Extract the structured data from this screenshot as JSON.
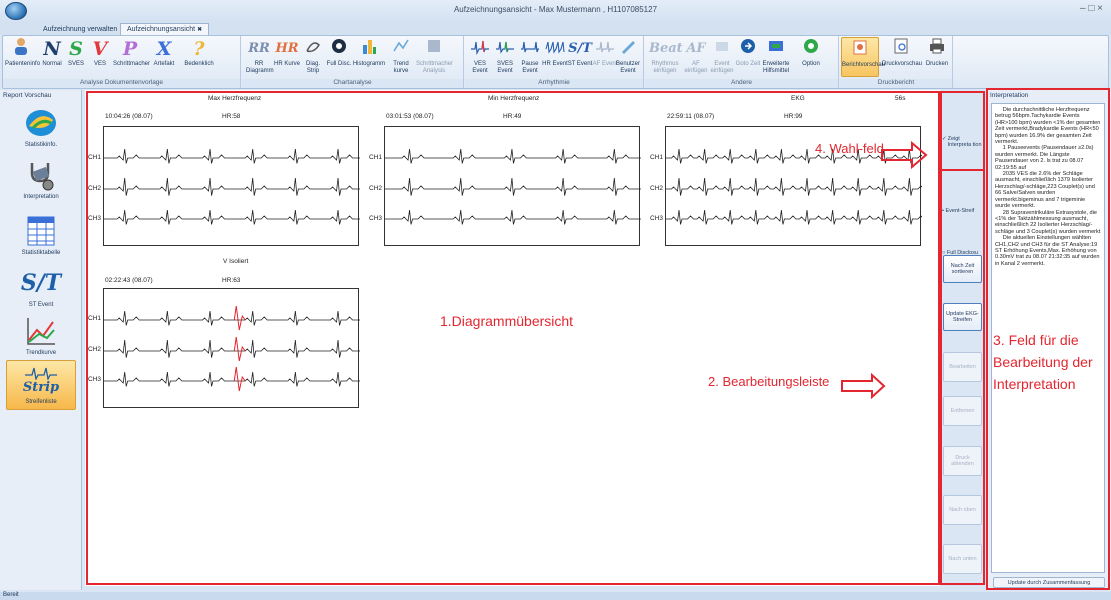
{
  "window": {
    "title": "Aufzeichnungsansicht - Max Mustermann , H1107085127",
    "controls": "– □ ×"
  },
  "tabs": [
    {
      "label": "Aufzeichnung verwalten"
    },
    {
      "label": "Aufzeichnungsansicht",
      "close": "✖"
    }
  ],
  "ribbon": {
    "groups": {
      "analysis_template": "Analyse Dokumentenvorlage",
      "chart_analysis": "Chartanalyse",
      "arrhythmia": "Arrhythmie",
      "other": "Andere",
      "print_report": "Druckbericht"
    },
    "buttons": {
      "patient_info": "Patienteninfo",
      "normal": "Normal",
      "sves": "SVES",
      "ves": "VES",
      "pacemaker": "Schrittmacher",
      "artifact": "Artefakt",
      "questionable": "Bedenklich",
      "rr_diagram": "RR Diagramm",
      "hr_curve": "HR Kurve",
      "diag_strip": "Diag. Strip",
      "full_disc": "Full Disc.",
      "histogram": "Histogramm",
      "trend_curve": "Trend kurve",
      "pacemaker_analysis": "Schrittmacher Analysis",
      "ves_event": "VES Event",
      "sves_event": "SVES Event",
      "pause_event": "Pause Event",
      "hr_event": "HR Event",
      "st_event": "ST Event",
      "af_event": "AF Event",
      "user_event": "Benutzer Event",
      "rhythm_insert": "Rhythmus einfügen",
      "af_insert": "AF einfügen",
      "event_insert": "Event einfügen",
      "goto_time": "Goto Zeit",
      "ext_tools": "Erweiterte Hilfsmittel",
      "option": "Option",
      "report_preview": "Berichtvorschau",
      "print_preview": "Druckvorschau",
      "print": "Drucken"
    },
    "icon_text": {
      "n": "N",
      "s": "S",
      "v": "V",
      "p": "P",
      "x": "X",
      "q": "?",
      "rr": "RR",
      "hr": "HR",
      "st": "S/T",
      "beat": "Beat",
      "af": "AF"
    }
  },
  "left_panel": {
    "title": "Report Vorschau",
    "items": [
      {
        "label": "Statistikinfo."
      },
      {
        "label": "Interpretation"
      },
      {
        "label": "Statistiktabelle"
      },
      {
        "label": "ST Event",
        "icon": "S/T"
      },
      {
        "label": "Trendkurve"
      },
      {
        "label": "Streifenliste",
        "icon": "Strip"
      }
    ]
  },
  "main": {
    "col_titles": {
      "max": "Max Herzfrequenz",
      "min": "Min Herzfrequenz",
      "ekg": "EKG",
      "dur": "56s",
      "visol": "V Isoliert"
    },
    "strips": [
      {
        "time": "10:04:26 (08.07)",
        "hr": "HR:58"
      },
      {
        "time": "03:01:53 (08.07)",
        "hr": "HR:49"
      },
      {
        "time": "22:59:11 (08.07)",
        "hr": "HR:99"
      },
      {
        "time": "02:22:43 (08.07)",
        "hr": "HR:63"
      }
    ],
    "channels": [
      "CH1",
      "CH2",
      "CH3"
    ]
  },
  "right_bar": {
    "show_interp": "Zeigt Interpreta tion",
    "check": "✓",
    "event_strip": "Event-Streif",
    "full_disclosure": "Full Disclosu",
    "sort_time": "Nach Zeit sortieren",
    "update_ekg": "Update EKG-Streifen",
    "edit": "Bearbeiten",
    "remove": "Entfernen",
    "print_hide": "Druck ablenden",
    "move_up": "Nach oben",
    "move_down": "Nach unten"
  },
  "interpretation": {
    "title": "Interpretation",
    "text": "     Die durchschnittliche Herzfrequenz betrug 56bpm.Tachykardie Events (HR>100 bpm) wurden <1% der gesamten Zeit vermerkt,Bradykardie Events (HR<50 bpm) wurden 16.9% der gesamten Zeit vermerkt.\n     1 Pauseevents (Pausendauer ≥2.0s) wurden vermerkt. Die Längste Pausendauer von 2. ls trat zu 08.07  02:19:55 auf\n     2035 VES die 2.6% der Schläge ausmacht, einschließlich 1379 Isolierter Herzschlag/-schläge,223 Couplet(s) und 66 Salve/Salven wurden vermerkt.bigeminus and 7 trigeminie wurde vermerkt.\n     28 Supraventrikuläre Extrasystole, die <1% der Taktzählmessung ausmacht, einschließlich 22 Isolierter Herzschlag/-schläge und 3 Couplet(s) wurden vermerkt\n     Die aktuellen Einstellungen wählten CH1,CH2 und CH3 für die ST Analyse:19 ST Erhöhung Events,Max. Erhöhung von 0.30mV trat zu 08.07 21:32:35 auf wurden in Kanal 2 vermerkt.",
    "update_button": "Update durch Zusammenfassung"
  },
  "status": {
    "text": "Bereit"
  },
  "annotations": {
    "a1": "1.Diagrammübersicht",
    "a2": "2. Bearbeitungsleiste",
    "a3": "3. Feld für die Bearbeitung der Interpretation",
    "a4": "4. Wahl-feld"
  },
  "colors": {
    "annotation": "#e3262f",
    "ecg": "#222222",
    "ecg_highlight": "#e3262f",
    "accent": "#1e395b"
  }
}
